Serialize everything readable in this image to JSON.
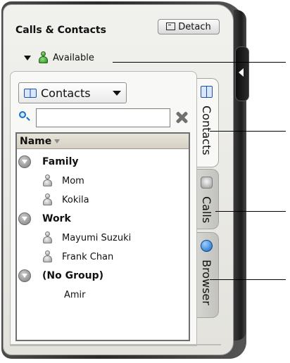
{
  "window": {
    "title": "Calls & Contacts",
    "detach_label": "Detach"
  },
  "status": {
    "label": "Available",
    "color": "#2f8a24"
  },
  "contacts_panel": {
    "source_selector": "Contacts",
    "search": {
      "value": "",
      "placeholder": ""
    },
    "column_header": "Name",
    "groups": [
      {
        "name": "Family",
        "contacts": [
          "Mom",
          "Kokila"
        ]
      },
      {
        "name": "Work",
        "contacts": [
          "Mayumi Suzuki",
          "Frank Chan"
        ]
      },
      {
        "name": "(No Group)",
        "contacts": [
          "Amir"
        ]
      }
    ]
  },
  "tabs": [
    {
      "label": "Contacts",
      "icon": "address-book-icon",
      "active": true
    },
    {
      "label": "Calls",
      "icon": "phone-icon",
      "active": false
    },
    {
      "label": "Browser",
      "icon": "browser-globe-icon",
      "active": false
    }
  ]
}
